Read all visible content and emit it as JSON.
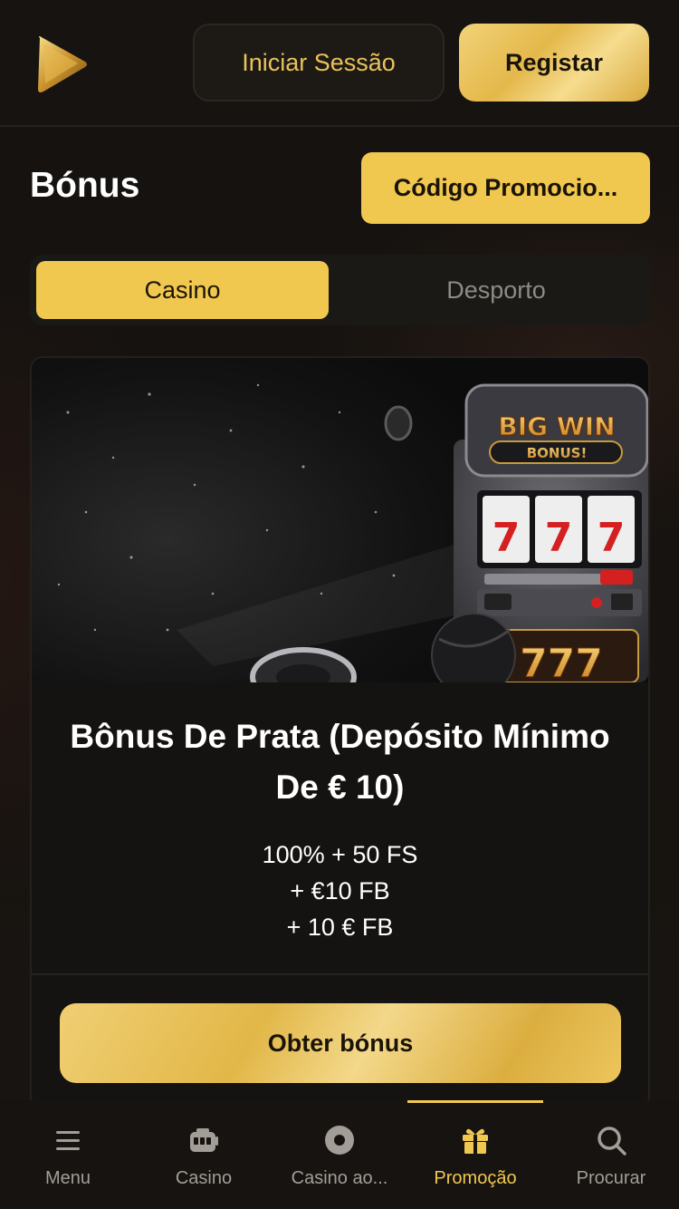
{
  "header": {
    "login_label": "Iniciar Sessão",
    "register_label": "Registar"
  },
  "page": {
    "title": "Bónus",
    "promo_code_label": "Código Promocio..."
  },
  "tabs": [
    {
      "label": "Casino",
      "selected": true
    },
    {
      "label": "Desporto",
      "selected": false
    }
  ],
  "bonus_card": {
    "banner": {
      "title": "BIG WIN",
      "subtitle": "BONUS!",
      "reels": [
        "7",
        "7",
        "7"
      ],
      "bottom_number": "777"
    },
    "title": "Bônus De Prata (Depósito Mínimo De € 10)",
    "details": [
      "100% + 50 FS",
      "+ €10 FB",
      "+ 10 € FB"
    ],
    "cta_label": "Obter bónus"
  },
  "bottom_nav": {
    "items": [
      {
        "label": "Menu",
        "icon": "menu-icon",
        "active": false
      },
      {
        "label": "Casino",
        "icon": "slot-machine-icon",
        "active": false
      },
      {
        "label": "Casino ao...",
        "icon": "live-casino-icon",
        "active": false
      },
      {
        "label": "Promoção",
        "icon": "gift-icon",
        "active": true
      },
      {
        "label": "Procurar",
        "icon": "search-icon",
        "active": false
      }
    ]
  },
  "colors": {
    "accent": "#f1c84f",
    "background": "#141210",
    "inactive_text": "#a29d96"
  }
}
